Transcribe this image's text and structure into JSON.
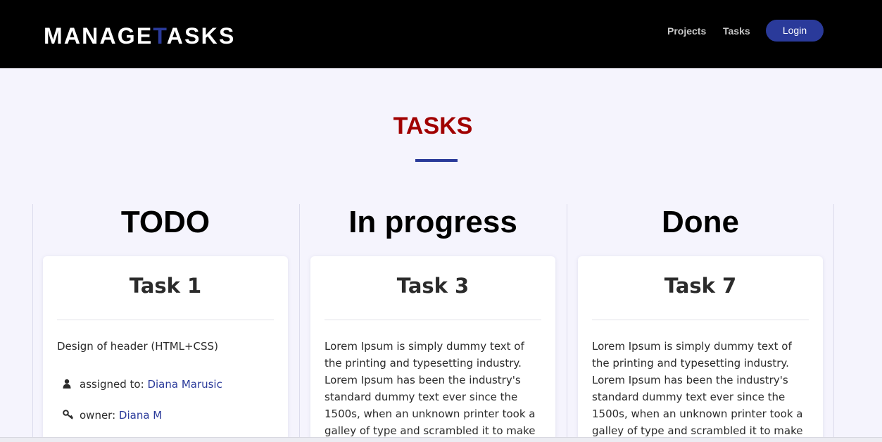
{
  "header": {
    "logo": {
      "part1": "MANAGE",
      "accent": "T",
      "part2": "ASKS"
    },
    "nav": {
      "projects": "Projects",
      "tasks": "Tasks",
      "login": "Login"
    }
  },
  "page": {
    "title": "TASKS"
  },
  "columns": [
    {
      "heading": "TODO",
      "card": {
        "title": "Task 1",
        "description": "Design of header (HTML+CSS)",
        "assigned_label": "assigned to:",
        "assigned_value": "Diana Marusic",
        "owner_label": "owner:",
        "owner_value": "Diana M"
      }
    },
    {
      "heading": "In progress",
      "card": {
        "title": "Task 3",
        "description": "Lorem Ipsum is simply dummy text of the printing and typesetting industry. Lorem Ipsum has been the industry's standard dummy text ever since the 1500s, when an unknown printer took a galley of type and scrambled it to make a"
      }
    },
    {
      "heading": "Done",
      "card": {
        "title": "Task 7",
        "description": "Lorem Ipsum is simply dummy text of the printing and typesetting industry. Lorem Ipsum has been the industry's standard dummy text ever since the 1500s, when an unknown printer took a galley of type and scrambled it to make a"
      }
    }
  ],
  "colors": {
    "brand": "#2a3a9a",
    "title": "#a10000",
    "header_bg": "#000000",
    "page_bg": "#f5f4fd"
  },
  "icons": {
    "assigned": "user-icon",
    "owner": "key-icon"
  }
}
